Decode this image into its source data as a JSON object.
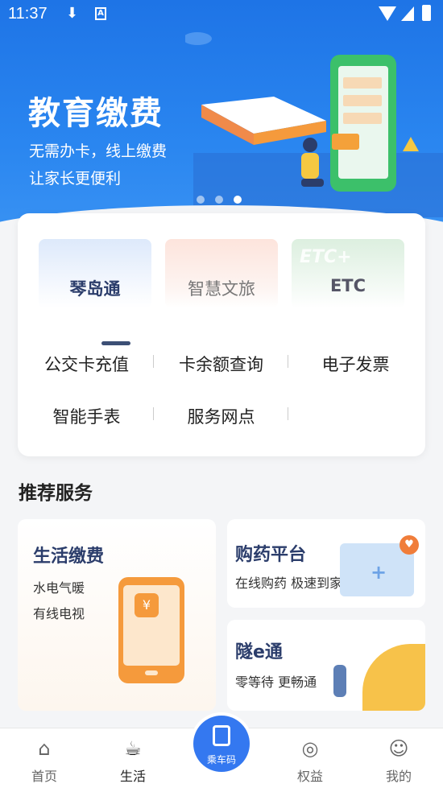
{
  "status_bar": {
    "time": "11:37"
  },
  "banner": {
    "title": "教育缴费",
    "sub1": "无需办卡，线上缴费",
    "sub2": "让家长更便利",
    "dots": 3,
    "active_dot": 0
  },
  "tabs": [
    {
      "label": "琴岛通",
      "active": true
    },
    {
      "label": "智慧文旅",
      "active": false
    },
    {
      "label": "ETC",
      "active": false
    }
  ],
  "services": [
    {
      "label": "公交卡充值"
    },
    {
      "label": "卡余额查询"
    },
    {
      "label": "电子发票"
    },
    {
      "label": "智能手表"
    },
    {
      "label": "服务网点"
    }
  ],
  "recommend": {
    "title": "推荐服务",
    "life": {
      "title": "生活缴费",
      "line1": "水电气暖",
      "line2": "有线电视"
    },
    "medicine": {
      "title": "购药平台",
      "desc": "在线购药 极速到家"
    },
    "tunnel": {
      "title": "隧e通",
      "desc": "零等待 更畅通"
    }
  },
  "bottom_nav": [
    {
      "label": "首页",
      "icon": "home-icon"
    },
    {
      "label": "生活",
      "icon": "cup-icon",
      "active": true
    },
    {
      "label": "乘车码",
      "icon": "bus-code-icon"
    },
    {
      "label": "权益",
      "icon": "medal-icon"
    },
    {
      "label": "我的",
      "icon": "user-icon"
    }
  ],
  "colors": {
    "primary": "#2a86f0",
    "ride_button": "#3478f0",
    "title_dark": "#2b3d6b"
  }
}
